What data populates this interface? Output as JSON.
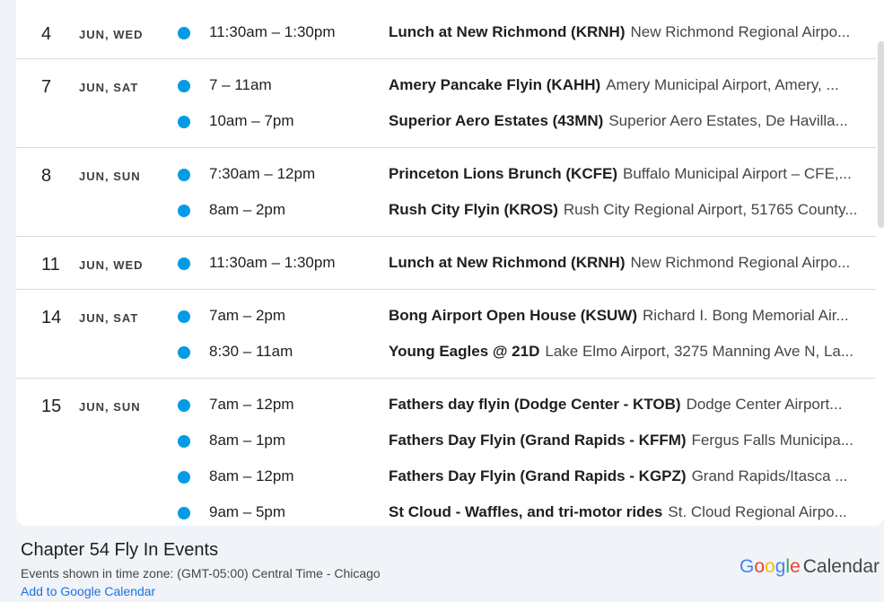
{
  "days": [
    {
      "num": "4",
      "weekday": "JUN, WED",
      "events": [
        {
          "time": "11:30am – 1:30pm",
          "title": "Lunch at New Richmond (KRNH)",
          "location": "New Richmond Regional Airpo..."
        }
      ]
    },
    {
      "num": "7",
      "weekday": "JUN, SAT",
      "events": [
        {
          "time": "7 – 11am",
          "title": "Amery Pancake Flyin (KAHH)",
          "location": "Amery Municipal Airport, Amery, ..."
        },
        {
          "time": "10am – 7pm",
          "title": "Superior Aero Estates (43MN)",
          "location": "Superior Aero Estates, De Havilla..."
        }
      ]
    },
    {
      "num": "8",
      "weekday": "JUN, SUN",
      "events": [
        {
          "time": "7:30am – 12pm",
          "title": "Princeton Lions Brunch (KCFE)",
          "location": "Buffalo Municipal Airport – CFE,..."
        },
        {
          "time": "8am – 2pm",
          "title": "Rush City Flyin (KROS)",
          "location": "Rush City Regional Airport, 51765 County..."
        }
      ]
    },
    {
      "num": "11",
      "weekday": "JUN, WED",
      "events": [
        {
          "time": "11:30am – 1:30pm",
          "title": "Lunch at New Richmond (KRNH)",
          "location": "New Richmond Regional Airpo..."
        }
      ]
    },
    {
      "num": "14",
      "weekday": "JUN, SAT",
      "events": [
        {
          "time": "7am – 2pm",
          "title": "Bong Airport Open House (KSUW)",
          "location": "Richard I. Bong Memorial Air..."
        },
        {
          "time": "8:30 – 11am",
          "title": "Young Eagles @ 21D",
          "location": "Lake Elmo Airport, 3275 Manning Ave N, La..."
        }
      ]
    },
    {
      "num": "15",
      "weekday": "JUN, SUN",
      "events": [
        {
          "time": "7am – 12pm",
          "title": "Fathers day flyin (Dodge Center - KTOB)",
          "location": "Dodge Center Airport..."
        },
        {
          "time": "8am – 1pm",
          "title": "Fathers Day Flyin (Grand Rapids - KFFM)",
          "location": "Fergus Falls Municipa..."
        },
        {
          "time": "8am – 12pm",
          "title": "Fathers Day Flyin (Grand Rapids - KGPZ)",
          "location": "Grand Rapids/Itasca ..."
        },
        {
          "time": "9am – 5pm",
          "title": "St Cloud - Waffles, and tri-motor rides",
          "location": "St. Cloud Regional Airpo..."
        }
      ]
    }
  ],
  "footer": {
    "title": "Chapter 54 Fly In Events",
    "timezone": "Events shown in time zone: (GMT-05:00) Central Time - Chicago",
    "add_link": "Add to Google Calendar",
    "brand_letters": [
      {
        "ch": "G",
        "color": "#4285f4"
      },
      {
        "ch": "o",
        "color": "#ea4335"
      },
      {
        "ch": "o",
        "color": "#fbbc05"
      },
      {
        "ch": "g",
        "color": "#4285f4"
      },
      {
        "ch": "l",
        "color": "#34a853"
      },
      {
        "ch": "e",
        "color": "#ea4335"
      }
    ],
    "brand_product": "Calendar"
  },
  "colors": {
    "event_dot": "#039be5",
    "link": "#1a73e8"
  }
}
